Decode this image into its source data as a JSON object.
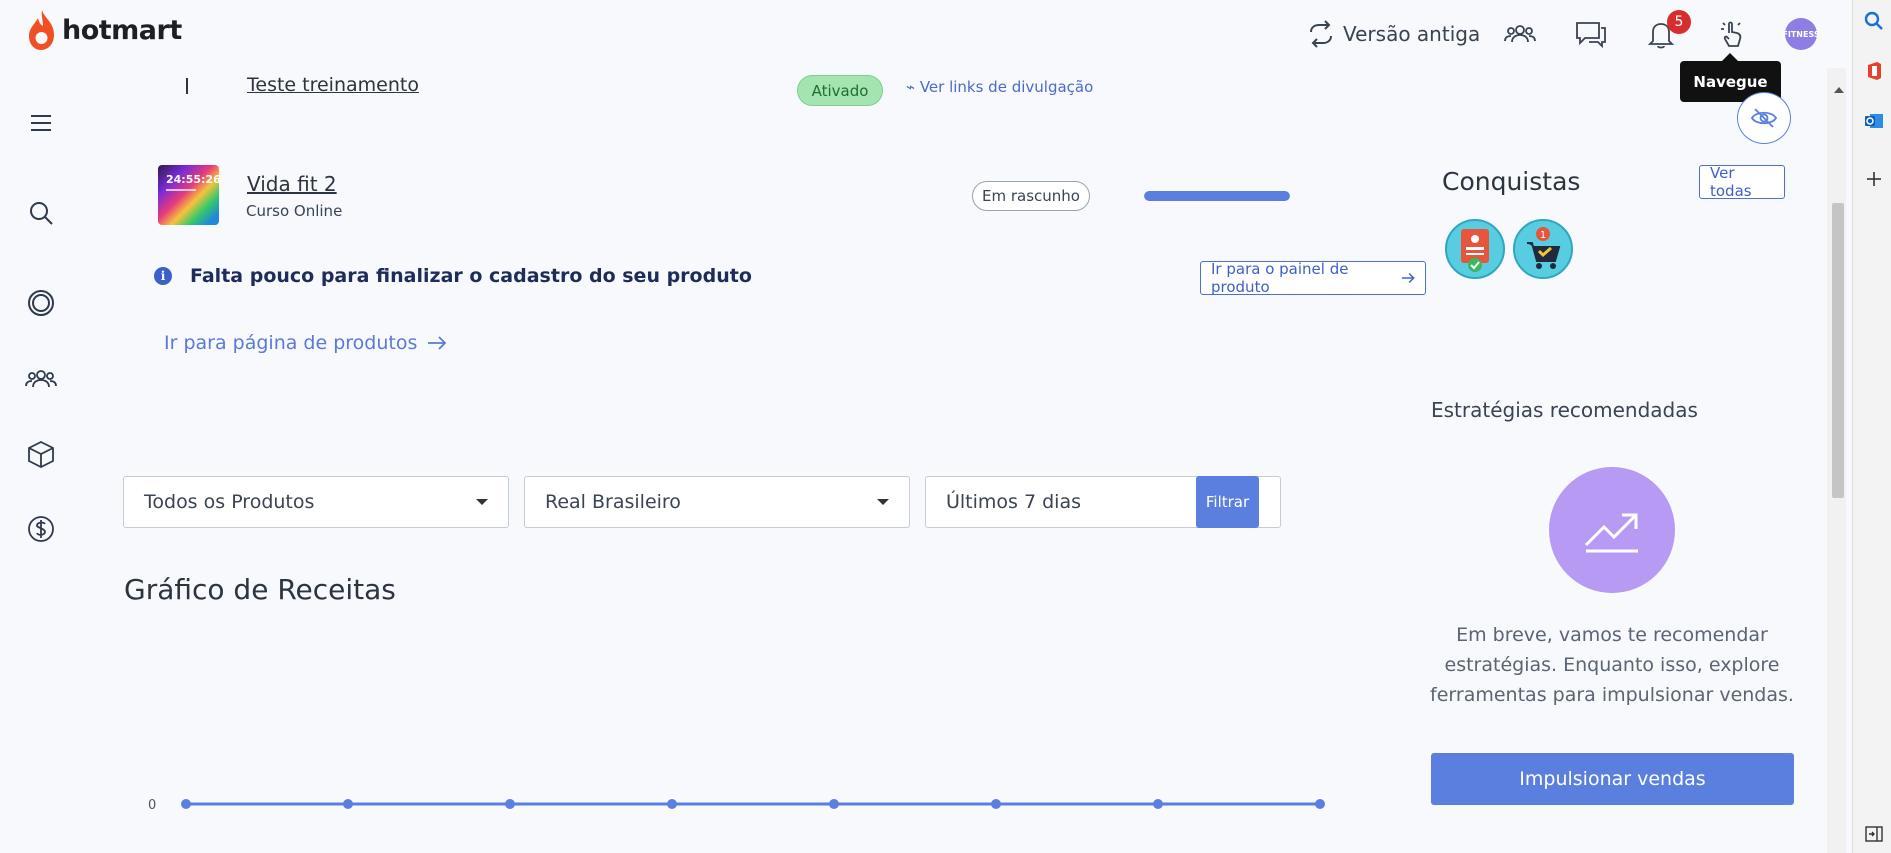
{
  "brand": {
    "name": "hotmart",
    "color": "#f04e23"
  },
  "topbar": {
    "versao_label": "Versão antiga",
    "notifications_count": "5",
    "avatar_text": "FITNESS",
    "tooltip": "Navegue"
  },
  "products": {
    "row1": {
      "title": "Teste treinamento",
      "status": "Ativado",
      "link": "Ver links de divulgação"
    },
    "row2": {
      "title": "Vida fit 2",
      "subtitle": "Curso Online",
      "thumb_text": "24:55:26",
      "status": "Em rascunho",
      "progress": 1.0
    },
    "notice": "Falta pouco para finalizar o cadastro do seu produto",
    "notice_button": "Ir para o painel de produto",
    "all_link": "Ir para página de produtos"
  },
  "filters": {
    "product": "Todos os Produtos",
    "currency": "Real Brasileiro",
    "period": "Últimos 7 dias",
    "button": "Filtrar"
  },
  "chart_title": "Gráfico de Receitas",
  "chart_data": {
    "type": "line",
    "y_tick": "0",
    "values": [
      0,
      0,
      0,
      0,
      0,
      0,
      0,
      0
    ],
    "color": "#5a7fdf"
  },
  "right_panel": {
    "conquistas_title": "Conquistas",
    "ver_todas": "Ver todas",
    "estrategias_title": "Estratégias recomendadas",
    "estrategias_desc": "Em breve, vamos te recomendar estratégias. Enquanto isso, explore ferramentas para impulsionar vendas.",
    "impulsionar_button": "Impulsionar vendas"
  },
  "colors": {
    "accent": "#5a7fdf",
    "ativado_bg": "#a3e4b0",
    "badge_red": "#d62d2d"
  }
}
